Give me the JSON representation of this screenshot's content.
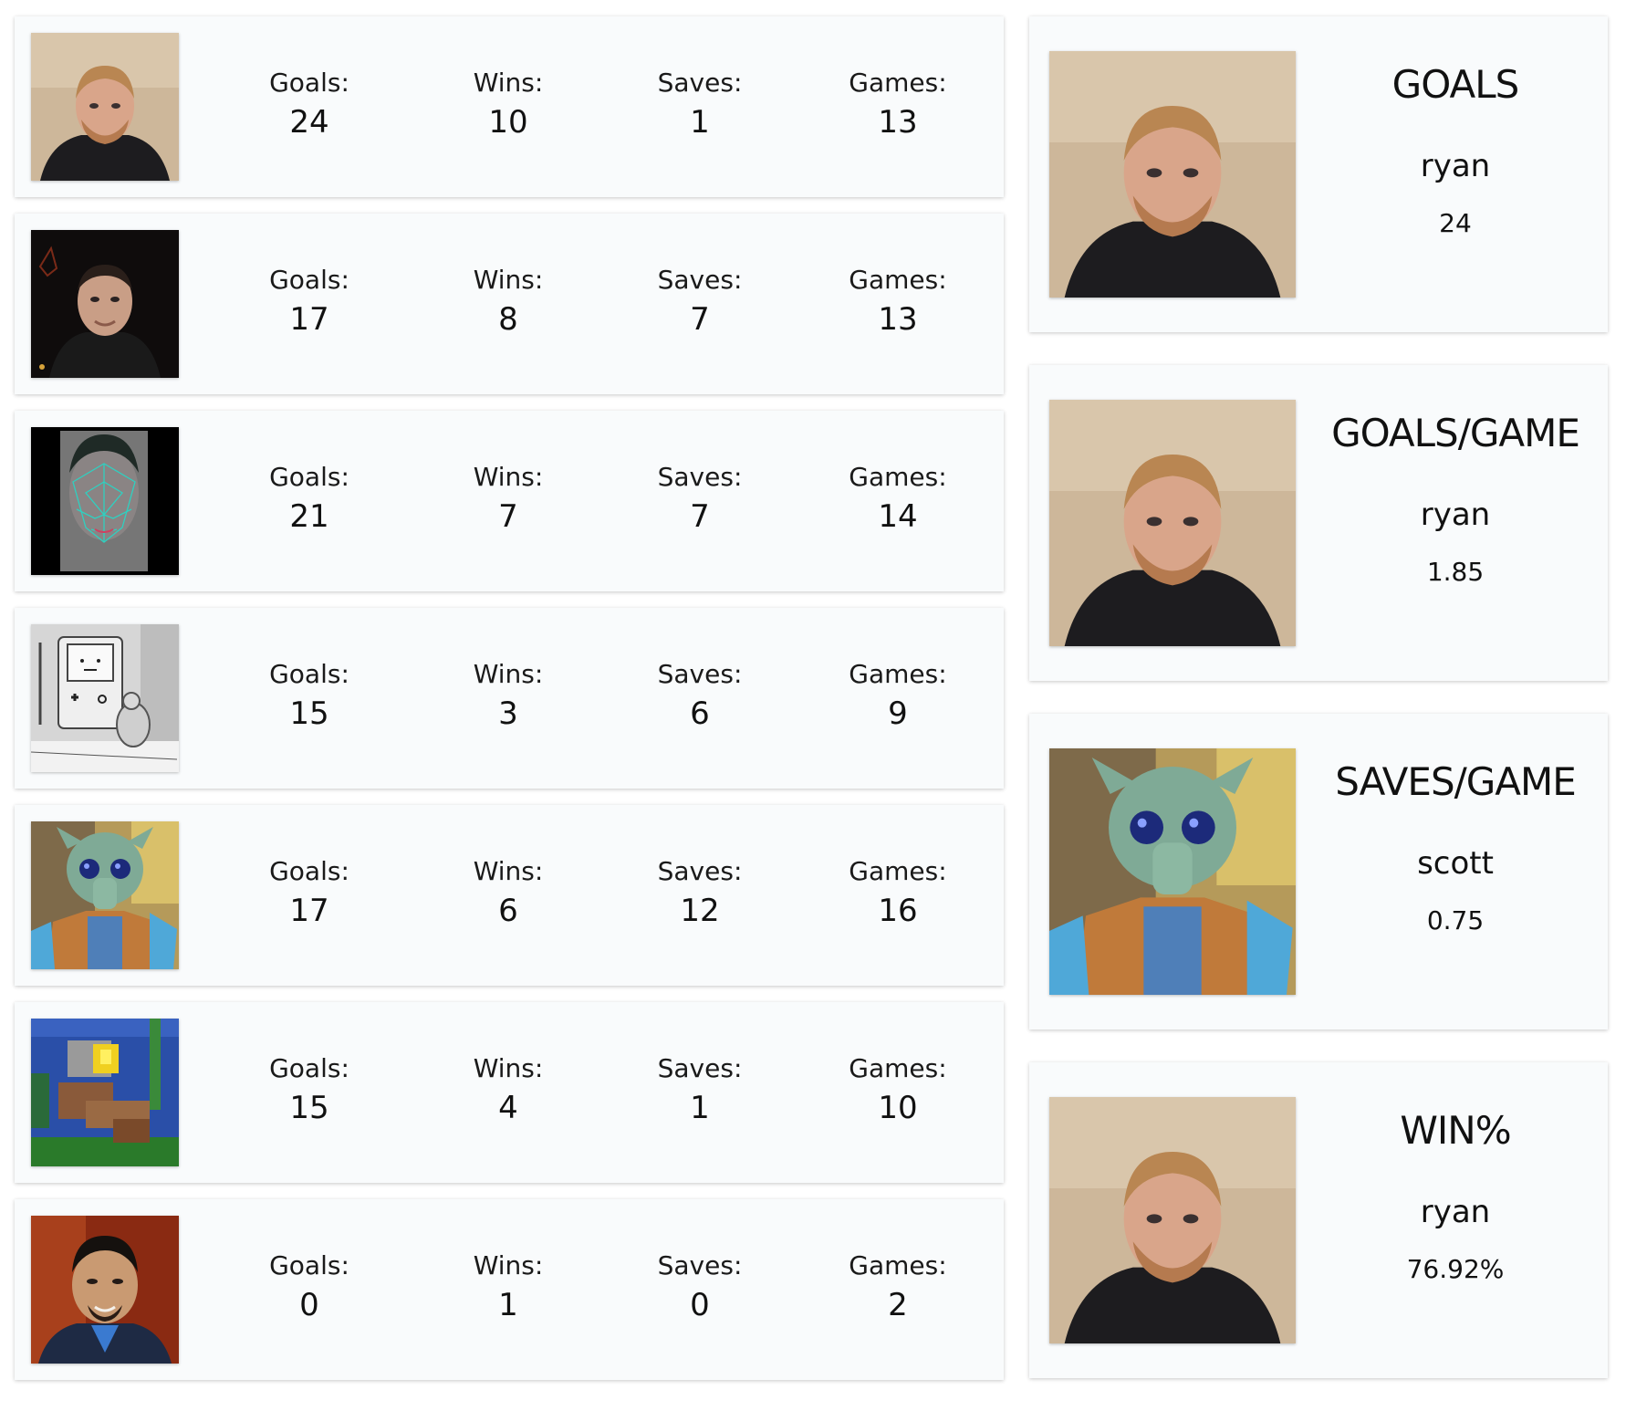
{
  "players": [
    {
      "avatar_icon": "ryan-photo-icon",
      "goals_label": "Goals:",
      "goals": "24",
      "wins_label": "Wins:",
      "wins": "10",
      "saves_label": "Saves:",
      "saves": "1",
      "games_label": "Games:",
      "games": "13"
    },
    {
      "avatar_icon": "man-dark-photo-icon",
      "goals_label": "Goals:",
      "goals": "17",
      "wins_label": "Wins:",
      "wins": "8",
      "saves_label": "Saves:",
      "saves": "7",
      "games_label": "Games:",
      "games": "13"
    },
    {
      "avatar_icon": "wireframe-face-icon",
      "goals_label": "Goals:",
      "goals": "21",
      "wins_label": "Wins:",
      "wins": "7",
      "saves_label": "Saves:",
      "saves": "7",
      "games_label": "Games:",
      "games": "14"
    },
    {
      "avatar_icon": "bmo-cartoon-icon",
      "goals_label": "Goals:",
      "goals": "15",
      "wins_label": "Wins:",
      "wins": "3",
      "saves_label": "Saves:",
      "saves": "6",
      "games_label": "Games:",
      "games": "9"
    },
    {
      "avatar_icon": "greedo-figure-icon",
      "goals_label": "Goals:",
      "goals": "17",
      "wins_label": "Wins:",
      "wins": "6",
      "saves_label": "Saves:",
      "saves": "12",
      "games_label": "Games:",
      "games": "16"
    },
    {
      "avatar_icon": "pixel-art-icon",
      "goals_label": "Goals:",
      "goals": "15",
      "wins_label": "Wins:",
      "wins": "4",
      "saves_label": "Saves:",
      "saves": "1",
      "games_label": "Games:",
      "games": "10"
    },
    {
      "avatar_icon": "man-red-background-photo-icon",
      "goals_label": "Goals:",
      "goals": "0",
      "wins_label": "Wins:",
      "wins": "1",
      "saves_label": "Saves:",
      "saves": "0",
      "games_label": "Games:",
      "games": "2"
    }
  ],
  "leaders": [
    {
      "category": "GOALS",
      "name": "ryan",
      "value": "24",
      "avatar_icon": "ryan-photo-icon"
    },
    {
      "category": "GOALS/GAME",
      "name": "ryan",
      "value": "1.85",
      "avatar_icon": "ryan-photo-icon"
    },
    {
      "category": "SAVES/GAME",
      "name": "scott",
      "value": "0.75",
      "avatar_icon": "greedo-figure-icon"
    },
    {
      "category": "WIN%",
      "name": "ryan",
      "value": "76.92%",
      "avatar_icon": "ryan-photo-icon"
    }
  ]
}
